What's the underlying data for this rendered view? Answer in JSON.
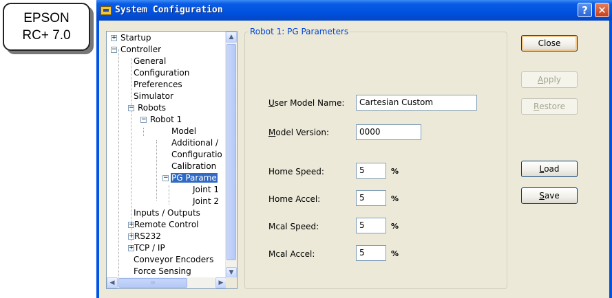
{
  "badge": {
    "line1": "EPSON",
    "line2": "RC+ 7.0"
  },
  "window": {
    "title": "System Configuration",
    "help_label": "?",
    "close_glyph": "✕"
  },
  "tree": {
    "nodes": [
      {
        "label": "Startup",
        "expander": "+"
      },
      {
        "label": "Controller",
        "expander": "−"
      },
      {
        "label": "General"
      },
      {
        "label": "Configuration"
      },
      {
        "label": "Preferences"
      },
      {
        "label": "Simulator"
      },
      {
        "label": "Robots",
        "expander": "−"
      },
      {
        "label": "Robot 1",
        "expander": "−"
      },
      {
        "label": "Model"
      },
      {
        "label": "Additional /"
      },
      {
        "label": "Configuratio"
      },
      {
        "label": "Calibration"
      },
      {
        "label": "PG Parame",
        "expander": "−",
        "selected": true
      },
      {
        "label": "Joint 1"
      },
      {
        "label": "Joint 2"
      },
      {
        "label": "Inputs / Outputs"
      },
      {
        "label": "Remote Control",
        "expander": "+"
      },
      {
        "label": "RS232",
        "expander": "+"
      },
      {
        "label": "TCP / IP",
        "expander": "+"
      },
      {
        "label": "Conveyor Encoders"
      },
      {
        "label": "Force Sensing"
      }
    ],
    "scroll_up": "▲",
    "scroll_down": "▼",
    "scroll_left": "◀",
    "scroll_right": "▶",
    "hthumb_grip": "III"
  },
  "group": {
    "title": "Robot 1: PG Parameters",
    "user_model_name": {
      "mnemonic": "U",
      "label_rest": "ser Model Name:",
      "value": "Cartesian Custom"
    },
    "model_version": {
      "mnemonic": "M",
      "label_rest": "odel Version:",
      "value": "0000"
    },
    "home_speed": {
      "label": "Home Speed:",
      "value": "5",
      "unit": "%"
    },
    "home_accel": {
      "label": "Home Accel:",
      "value": "5",
      "unit": "%"
    },
    "mcal_speed": {
      "label": "Mcal Speed:",
      "value": "5",
      "unit": "%"
    },
    "mcal_accel": {
      "label": "Mcal Accel:",
      "value": "5",
      "unit": "%"
    }
  },
  "buttons": {
    "close": "Close",
    "apply_mnemonic": "A",
    "apply_rest": "pply",
    "restore_mnemonic": "R",
    "restore_rest": "estore",
    "load_mnemonic": "L",
    "load_rest": "oad",
    "save_mnemonic": "S",
    "save_rest": "ave"
  },
  "colors": {
    "titlebar": "#0054e3",
    "selection": "#316ac5",
    "group_title": "#0046d5"
  }
}
